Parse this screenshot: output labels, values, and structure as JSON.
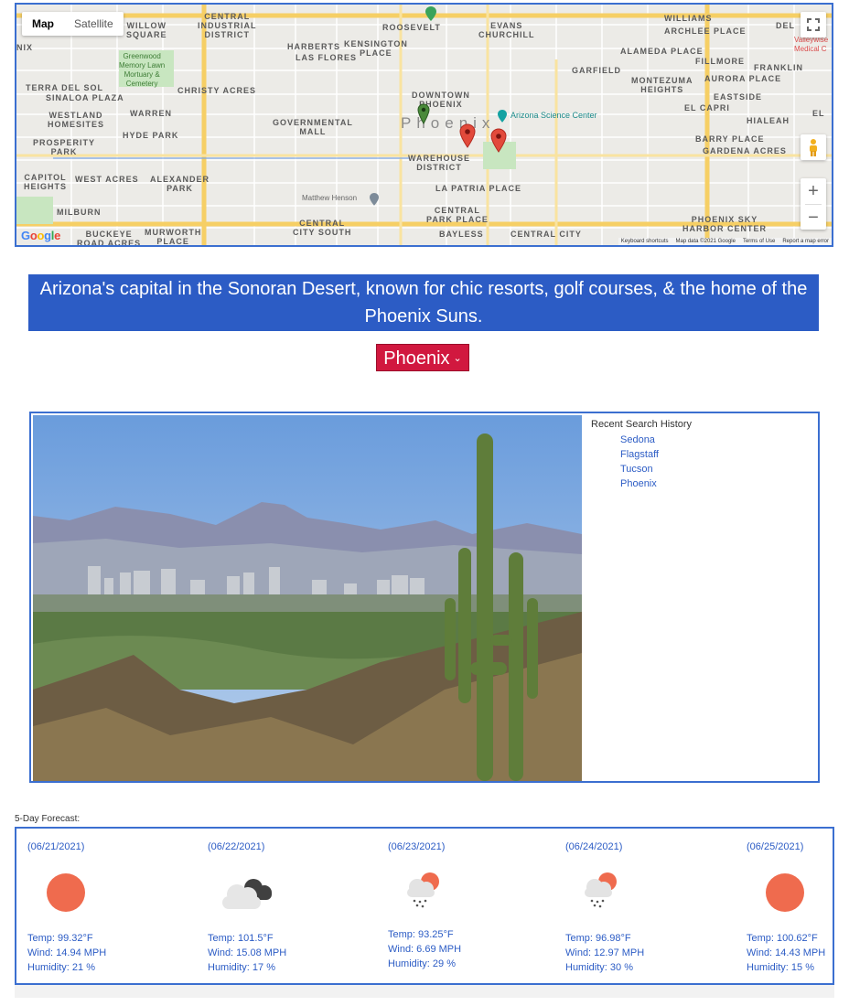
{
  "map": {
    "type_map": "Map",
    "type_satellite": "Satellite",
    "google": "Google",
    "footer": {
      "shortcuts": "Keyboard shortcuts",
      "mapdata": "Map data ©2021 Google",
      "terms": "Terms of Use",
      "report": "Report a map error"
    },
    "labels": {
      "central_industrial": "CENTRAL\nINDUSTRIAL\nDISTRICT",
      "willow": "WILLOW\nSQUARE",
      "roosevelt": "ROOSEVELT",
      "evans": "EVANS\nCHURCHILL",
      "williams": "WILLIAMS",
      "archlee": "ARCHLEE PLACE",
      "del": "DEL",
      "nix": "NIX",
      "harbert": "HARBERTS",
      "kensington": "KENSINGTON\nPLACE",
      "las_flores": "LAS FLORES",
      "alameda": "ALAMEDA PLACE",
      "garfield": "GARFIELD",
      "fillmore": "FILLMORE",
      "franklin": "FRANKLIN",
      "montezuma": "MONTEZUMA\nHEIGHTS",
      "aurora": "AURORA PLACE",
      "greenwood": "Greenwood\nMemory Lawn\nMortuary &\nCemetery",
      "terra": "TERRA DEL SOL",
      "sinaloa": "SINALOA PLAZA",
      "christy": "CHRISTY ACRES",
      "downtown": "DOWNTOWN\nPHOENIX",
      "eastside": "EASTSIDE",
      "el_capri": "EL CAPRI",
      "hialeah": "HIALEAH",
      "westland": "WESTLAND\nHOMESITES",
      "warren": "WARREN",
      "governmental": "GOVERNMENTAL\nMALL",
      "science_center": "Arizona Science Center",
      "hyde": "HYDE PARK",
      "prosperity": "PROSPERITY\nPARK",
      "phoenix": "Phoenix",
      "barry": "BARRY PLACE",
      "gardena": "GARDENA ACRES",
      "warehouse": "WAREHOUSE\nDISTRICT",
      "capitol": "CAPITOL\nHEIGHTS",
      "west_acres": "WEST ACRES",
      "alexander": "ALEXANDER\nPARK",
      "la_patria": "LA PATRIA PLACE",
      "matthew": "Matthew Henson",
      "milburn": "MILBURN",
      "central_park": "CENTRAL\nPARK PLACE",
      "central_city_south": "CENTRAL\nCITY SOUTH",
      "buckeye": "BUCKEYE\nROAD ACRES",
      "murworth": "MURWORTH\nPLACE",
      "bayless": "BAYLESS",
      "central_city": "CENTRAL CITY",
      "sky_harbor": "PHOENIX SKY\nHARBOR CENTER",
      "el": "EL",
      "valleywise": "Valleywise\nMedical C"
    }
  },
  "description": "Arizona's capital in the Sonoran Desert, known for chic resorts, golf courses, & the home of the Phoenix Suns.",
  "city_select": {
    "selected": "Phoenix"
  },
  "history": {
    "title": "Recent Search History",
    "items": [
      "Sedona",
      "Flagstaff",
      "Tucson",
      "Phoenix"
    ]
  },
  "forecast": {
    "title": "5-Day Forecast:",
    "days": [
      {
        "date": "(06/21/2021)",
        "icon": "sun-icon",
        "temp": "Temp: 99.32°F",
        "wind": "Wind: 14.94 MPH",
        "humidity": "Humidity: 21 %"
      },
      {
        "date": "(06/22/2021)",
        "icon": "cloudy-icon",
        "temp": "Temp: 101.5°F",
        "wind": "Wind: 15.08 MPH",
        "humidity": "Humidity: 17 %"
      },
      {
        "date": "(06/23/2021)",
        "icon": "rain-sun-icon",
        "temp": "Temp: 93.25°F",
        "wind": "Wind: 6.69 MPH",
        "humidity": "Humidity: 29 %"
      },
      {
        "date": "(06/24/2021)",
        "icon": "rain-sun-icon",
        "temp": "Temp: 96.98°F",
        "wind": "Wind: 12.97 MPH",
        "humidity": "Humidity: 30 %"
      },
      {
        "date": "(06/25/2021)",
        "icon": "sun-icon",
        "temp": "Temp: 100.62°F",
        "wind": "Wind: 14.43 MPH",
        "humidity": "Humidity: 15 %"
      }
    ]
  },
  "colors": {
    "accent_blue": "#2c5cc5",
    "border_blue": "#3b6fd0",
    "select_red": "#d1183f",
    "sun": "#ef6b4e"
  }
}
